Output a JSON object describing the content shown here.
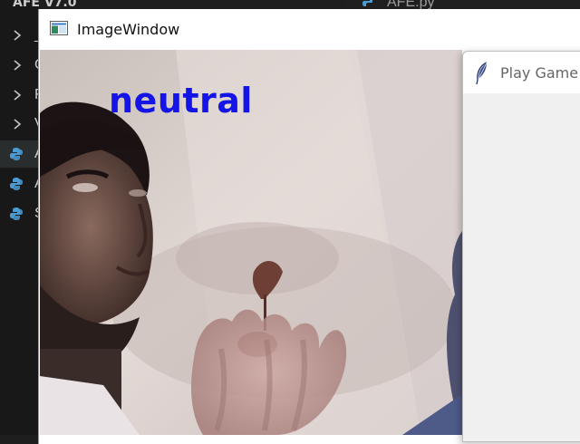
{
  "explorer": {
    "project_title": "AFE V7.0",
    "items": [
      {
        "label": "_",
        "icon": "chevron-right-icon"
      },
      {
        "label": "C",
        "icon": "chevron-right-icon"
      },
      {
        "label": "F",
        "icon": "chevron-right-icon"
      },
      {
        "label": "V",
        "icon": "chevron-right-icon"
      },
      {
        "label": "A",
        "icon": "python-file-icon",
        "selected": true
      },
      {
        "label": "A",
        "icon": "python-file-icon"
      },
      {
        "label": "S",
        "icon": "python-file-icon"
      }
    ]
  },
  "editor": {
    "active_tab": "AFE.py"
  },
  "image_window": {
    "title": "ImageWindow",
    "emotion_label": "neutral",
    "emotion_label_color": "#1414e6"
  },
  "play_window": {
    "title": "Play Game"
  },
  "colors": {
    "vscode_bg": "#1e1e1e",
    "explorer_bg": "#181818",
    "python_icon": "#4b9bd4",
    "window_bg": "#ffffff",
    "tk_bg": "#f0f0f0"
  }
}
